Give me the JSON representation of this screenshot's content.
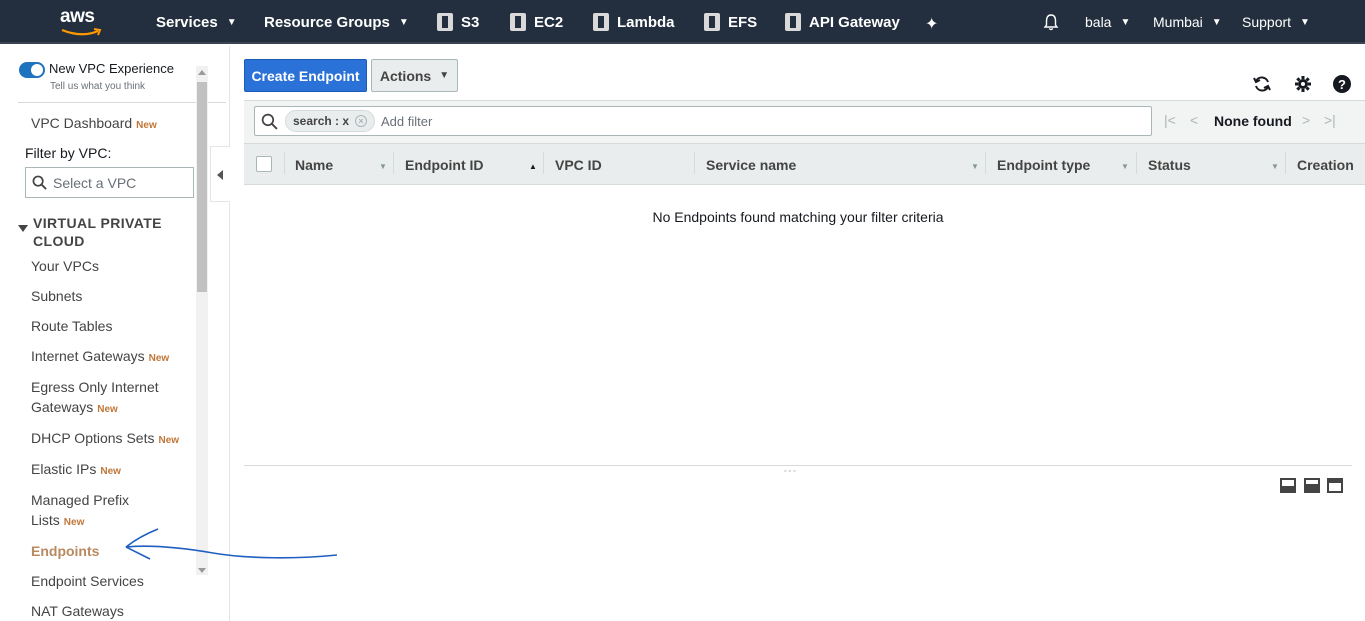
{
  "topnav": {
    "logo": "aws",
    "services": "Services",
    "resource_groups": "Resource Groups",
    "shortcuts": [
      {
        "label": "S3",
        "icon": "s3-icon"
      },
      {
        "label": "EC2",
        "icon": "ec2-icon"
      },
      {
        "label": "Lambda",
        "icon": "lambda-icon"
      },
      {
        "label": "EFS",
        "icon": "efs-icon"
      },
      {
        "label": "API Gateway",
        "icon": "api-gateway-icon"
      }
    ],
    "user": "bala",
    "region": "Mumbai",
    "support": "Support"
  },
  "sidebar": {
    "toggle_label": "New VPC Experience",
    "toggle_sub": "Tell us what you think",
    "dashboard": "VPC Dashboard",
    "new_badge": "New",
    "filter_label": "Filter by VPC:",
    "filter_placeholder": "Select a VPC",
    "section_title": "VIRTUAL PRIVATE CLOUD",
    "items": {
      "your_vpcs": "Your VPCs",
      "subnets": "Subnets",
      "route_tables": "Route Tables",
      "internet_gateways": "Internet Gateways",
      "egress_line1": "Egress Only Internet",
      "egress_line2": "Gateways",
      "dhcp": "DHCP Options Sets",
      "elastic_ips": "Elastic IPs",
      "prefix_line1": "Managed Prefix",
      "prefix_line2": "Lists",
      "endpoints": "Endpoints",
      "endpoint_services": "Endpoint Services",
      "nat_gateways": "NAT Gateways"
    }
  },
  "toolbar": {
    "create_label": "Create Endpoint",
    "actions_label": "Actions"
  },
  "filter": {
    "token": "search : x",
    "placeholder": "Add filter",
    "pager_status": "None found"
  },
  "table": {
    "columns": [
      "Name",
      "Endpoint ID",
      "VPC ID",
      "Service name",
      "Endpoint type",
      "Status",
      "Creation"
    ],
    "empty_message": "No Endpoints found matching your filter criteria"
  }
}
